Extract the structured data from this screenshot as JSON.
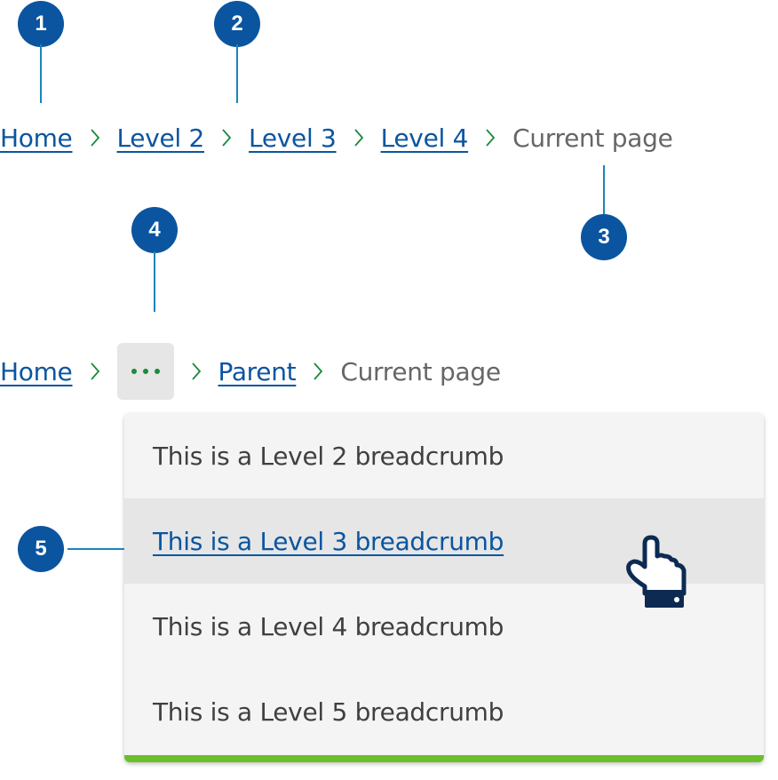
{
  "colors": {
    "badge": "#0b55a0",
    "callout_line": "#1a85b8",
    "link": "#0b55a0",
    "current": "#666666",
    "separator": "#1a8a3c",
    "menu_bg": "#f4f4f4",
    "menu_hover_bg": "#e6e6e6",
    "menu_accent": "#6abf2b"
  },
  "callouts": [
    "1",
    "2",
    "3",
    "4",
    "5"
  ],
  "breadcrumb_full": {
    "items": [
      {
        "label": "Home",
        "type": "link"
      },
      {
        "label": "Level 2",
        "type": "link"
      },
      {
        "label": "Level 3",
        "type": "link"
      },
      {
        "label": "Level 4",
        "type": "link"
      },
      {
        "label": "Current page",
        "type": "current"
      }
    ],
    "separator_icon": "chevron-right-icon"
  },
  "breadcrumb_collapsed": {
    "home": "Home",
    "overflow_icon": "more-horizontal-icon",
    "parent": "Parent",
    "current": "Current page",
    "menu": {
      "items": [
        {
          "label": "This is a Level 2 breadcrumb",
          "state": "default"
        },
        {
          "label": "This is a Level 3 breadcrumb",
          "state": "hover"
        },
        {
          "label": "This is a Level 4 breadcrumb",
          "state": "default"
        },
        {
          "label": "This is a Level 5 breadcrumb",
          "state": "default"
        }
      ]
    }
  },
  "cursor_icon": "hand-pointer-icon"
}
